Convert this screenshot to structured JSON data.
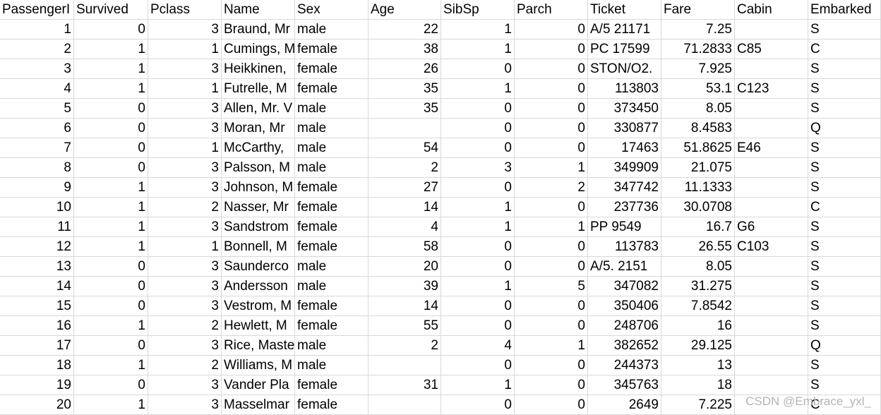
{
  "columns": [
    {
      "key": "PassengerId",
      "label": "PassengerI",
      "type": "num"
    },
    {
      "key": "Survived",
      "label": "Survived",
      "type": "num"
    },
    {
      "key": "Pclass",
      "label": "Pclass",
      "type": "num"
    },
    {
      "key": "Name",
      "label": "Name",
      "type": "txt"
    },
    {
      "key": "Sex",
      "label": "Sex",
      "type": "txt"
    },
    {
      "key": "Age",
      "label": "Age",
      "type": "num"
    },
    {
      "key": "SibSp",
      "label": "SibSp",
      "type": "num"
    },
    {
      "key": "Parch",
      "label": "Parch",
      "type": "num"
    },
    {
      "key": "Ticket",
      "label": "Ticket",
      "type": "mixed"
    },
    {
      "key": "Fare",
      "label": "Fare",
      "type": "num"
    },
    {
      "key": "Cabin",
      "label": "Cabin",
      "type": "txt"
    },
    {
      "key": "Embarked",
      "label": "Embarked",
      "type": "txt"
    }
  ],
  "rows": [
    [
      "1",
      "0",
      "3",
      "Braund, Mr",
      "male",
      "22",
      "1",
      "0",
      "A/5 21171",
      "7.25",
      "",
      "S"
    ],
    [
      "2",
      "1",
      "1",
      "Cumings, M",
      "female",
      "38",
      "1",
      "0",
      "PC 17599",
      "71.2833",
      "C85",
      "C"
    ],
    [
      "3",
      "1",
      "3",
      "Heikkinen,",
      "female",
      "26",
      "0",
      "0",
      "STON/O2.",
      "7.925",
      "",
      "S"
    ],
    [
      "4",
      "1",
      "1",
      "Futrelle, M",
      "female",
      "35",
      "1",
      "0",
      "113803",
      "53.1",
      "C123",
      "S"
    ],
    [
      "5",
      "0",
      "3",
      "Allen, Mr. V",
      "male",
      "35",
      "0",
      "0",
      "373450",
      "8.05",
      "",
      "S"
    ],
    [
      "6",
      "0",
      "3",
      "Moran, Mr",
      "male",
      "",
      "0",
      "0",
      "330877",
      "8.4583",
      "",
      "Q"
    ],
    [
      "7",
      "0",
      "1",
      "McCarthy,",
      "male",
      "54",
      "0",
      "0",
      "17463",
      "51.8625",
      "E46",
      "S"
    ],
    [
      "8",
      "0",
      "3",
      "Palsson, M",
      "male",
      "2",
      "3",
      "1",
      "349909",
      "21.075",
      "",
      "S"
    ],
    [
      "9",
      "1",
      "3",
      "Johnson, M",
      "female",
      "27",
      "0",
      "2",
      "347742",
      "11.1333",
      "",
      "S"
    ],
    [
      "10",
      "1",
      "2",
      "Nasser, Mr",
      "female",
      "14",
      "1",
      "0",
      "237736",
      "30.0708",
      "",
      "C"
    ],
    [
      "11",
      "1",
      "3",
      "Sandstrom",
      "female",
      "4",
      "1",
      "1",
      "PP 9549",
      "16.7",
      "G6",
      "S"
    ],
    [
      "12",
      "1",
      "1",
      "Bonnell, M",
      "female",
      "58",
      "0",
      "0",
      "113783",
      "26.55",
      "C103",
      "S"
    ],
    [
      "13",
      "0",
      "3",
      "Saunderco",
      "male",
      "20",
      "0",
      "0",
      "A/5. 2151",
      "8.05",
      "",
      "S"
    ],
    [
      "14",
      "0",
      "3",
      "Andersson",
      "male",
      "39",
      "1",
      "5",
      "347082",
      "31.275",
      "",
      "S"
    ],
    [
      "15",
      "0",
      "3",
      "Vestrom, M",
      "female",
      "14",
      "0",
      "0",
      "350406",
      "7.8542",
      "",
      "S"
    ],
    [
      "16",
      "1",
      "2",
      "Hewlett, M",
      "female",
      "55",
      "0",
      "0",
      "248706",
      "16",
      "",
      "S"
    ],
    [
      "17",
      "0",
      "3",
      "Rice, Maste",
      "male",
      "2",
      "4",
      "1",
      "382652",
      "29.125",
      "",
      "Q"
    ],
    [
      "18",
      "1",
      "2",
      "Williams, M",
      "male",
      "",
      "0",
      "0",
      "244373",
      "13",
      "",
      "S"
    ],
    [
      "19",
      "0",
      "3",
      "Vander Pla",
      "female",
      "31",
      "1",
      "0",
      "345763",
      "18",
      "",
      "S"
    ],
    [
      "20",
      "1",
      "3",
      "Masselmar",
      "female",
      "",
      "0",
      "0",
      "2649",
      "7.225",
      "",
      "C"
    ]
  ],
  "watermark": "CSDN @Embrace_yxl_"
}
